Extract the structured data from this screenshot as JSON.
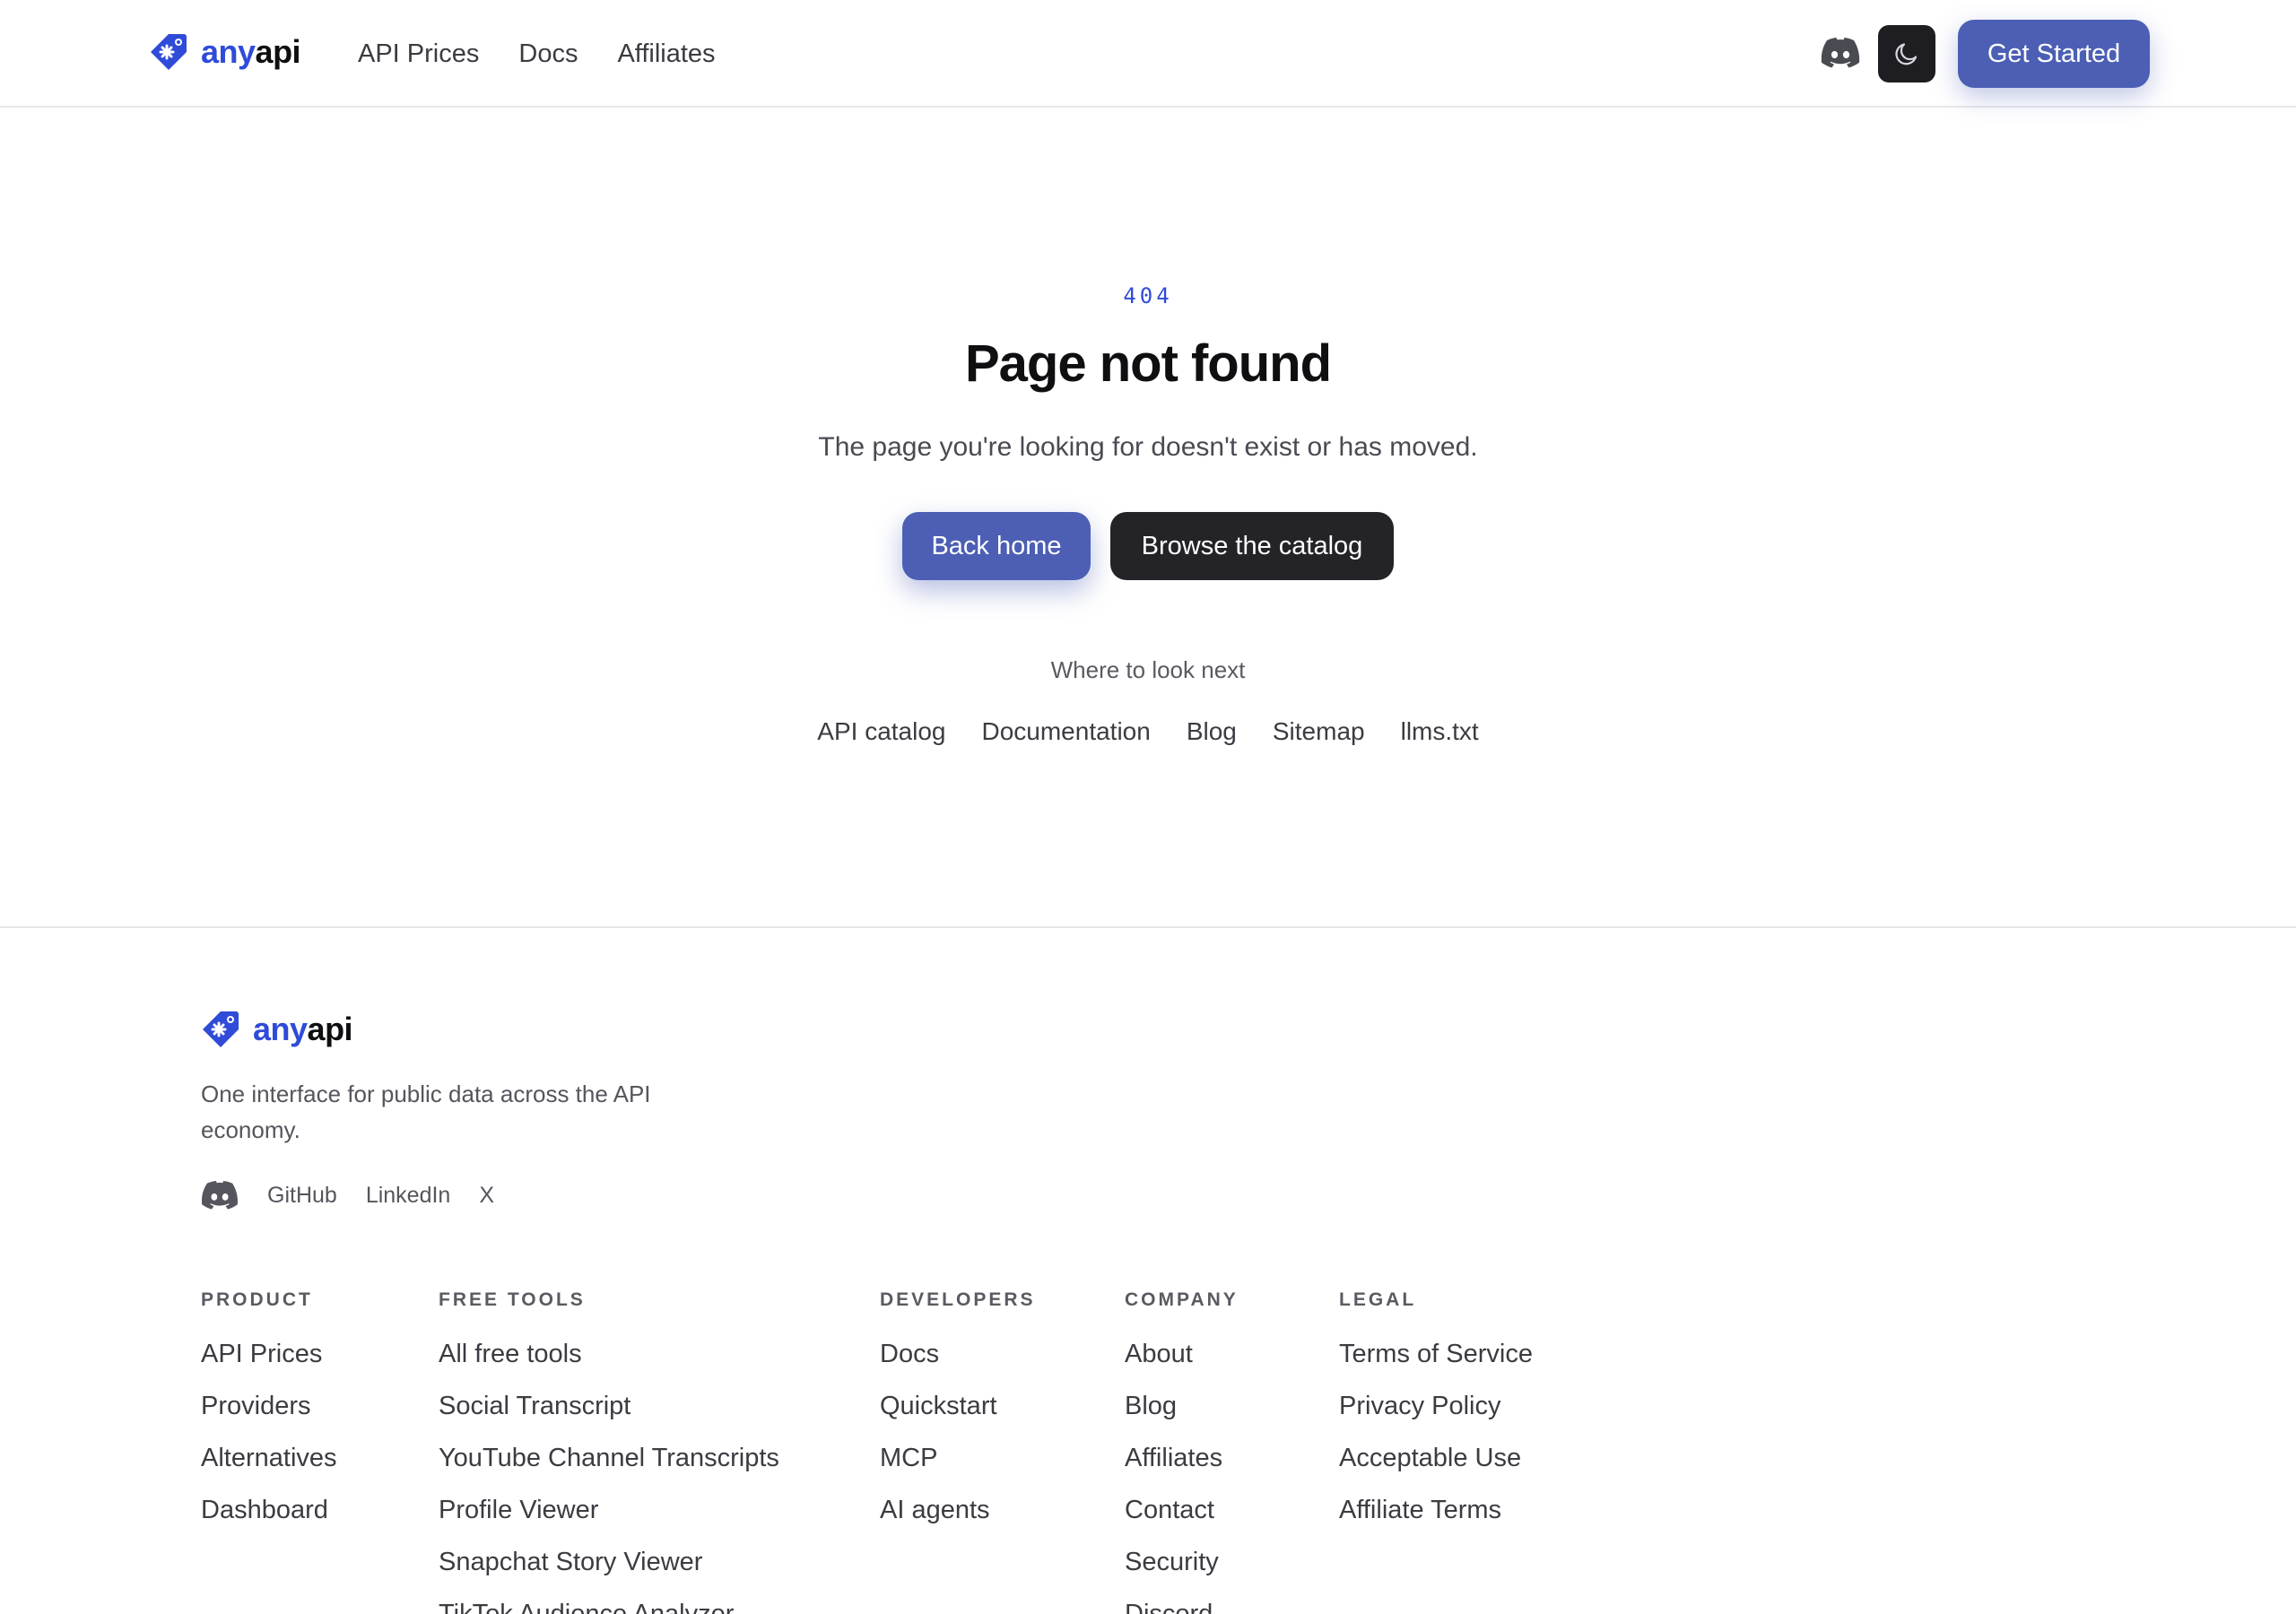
{
  "brand": {
    "any": "any",
    "api": "api"
  },
  "header": {
    "nav": [
      "API Prices",
      "Docs",
      "Affiliates"
    ],
    "cta": "Get Started",
    "icons": [
      "discord-icon",
      "moon-icon"
    ]
  },
  "main": {
    "code": "404",
    "title": "Page not found",
    "subtitle": "The page you're looking for doesn't exist or has moved.",
    "primary_button": "Back home",
    "secondary_button": "Browse the catalog",
    "next_label": "Where to look next",
    "next_links": [
      "API catalog",
      "Documentation",
      "Blog",
      "Sitemap",
      "llms.txt"
    ]
  },
  "footer": {
    "tagline": "One interface for public data across the API economy.",
    "socials": [
      "GitHub",
      "LinkedIn",
      "X"
    ],
    "columns": [
      {
        "heading": "PRODUCT",
        "links": [
          "API Prices",
          "Providers",
          "Alternatives",
          "Dashboard"
        ]
      },
      {
        "heading": "FREE TOOLS",
        "links": [
          "All free tools",
          "Social Transcript",
          "YouTube Channel Transcripts",
          "Profile Viewer",
          "Snapchat Story Viewer",
          "TikTok Audience Analyzer"
        ]
      },
      {
        "heading": "DEVELOPERS",
        "links": [
          "Docs",
          "Quickstart",
          "MCP",
          "AI agents"
        ]
      },
      {
        "heading": "COMPANY",
        "links": [
          "About",
          "Blog",
          "Affiliates",
          "Contact",
          "Security",
          "Discord"
        ]
      },
      {
        "heading": "LEGAL",
        "links": [
          "Terms of Service",
          "Privacy Policy",
          "Acceptable Use",
          "Affiliate Terms"
        ]
      }
    ]
  },
  "colors": {
    "brand_blue": "#2f4bd8",
    "button_indigo": "#4c5fb5",
    "button_dark": "#242428",
    "text_primary": "#0f0f12",
    "text_muted": "#55555d"
  }
}
